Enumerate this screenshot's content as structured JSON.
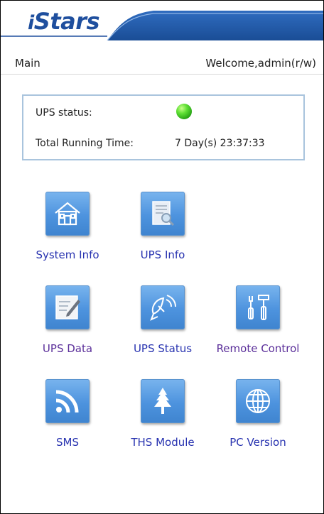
{
  "header": {
    "logo_i": "i",
    "logo_rest": "Stars"
  },
  "nav": {
    "main": "Main",
    "welcome": "Welcome,admin(r/w)"
  },
  "status": {
    "ups_status_label": "UPS status:",
    "ups_status_color": "#33cc22",
    "running_time_label": "Total Running Time:",
    "running_time_value": "7 Day(s) 23:37:33"
  },
  "menu": [
    {
      "label": "System Info",
      "icon": "house-icon"
    },
    {
      "label": "UPS Info",
      "icon": "search-document-icon"
    },
    {
      "label": "UPS Data",
      "icon": "edit-document-icon"
    },
    {
      "label": "UPS Status",
      "icon": "satellite-dish-icon"
    },
    {
      "label": "Remote Control",
      "icon": "tools-icon"
    },
    {
      "label": "SMS",
      "icon": "rss-icon"
    },
    {
      "label": "THS Module",
      "icon": "tree-icon"
    },
    {
      "label": "PC Version",
      "icon": "globe-icon"
    }
  ],
  "colors": {
    "tile": "#4d93de",
    "link_blue": "#2833b0",
    "link_purple": "#5b2f9a",
    "status_border": "#a9c4dd"
  }
}
